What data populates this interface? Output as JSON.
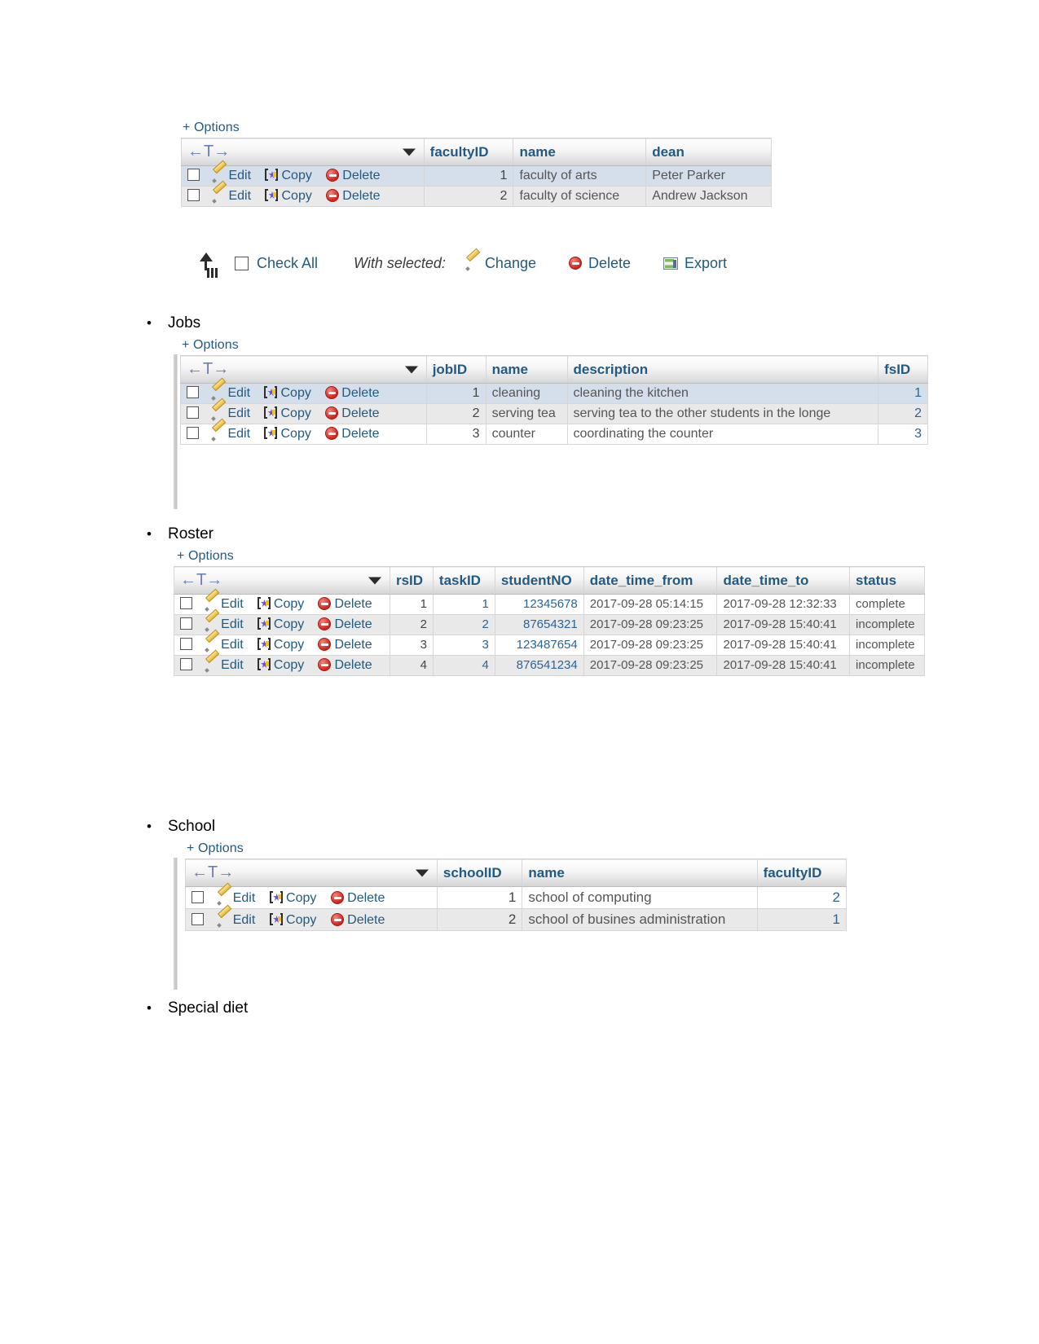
{
  "document": {
    "bullets": [
      {
        "label": "Jobs"
      },
      {
        "label": "Roster"
      },
      {
        "label": "School"
      },
      {
        "label": "Special diet"
      }
    ]
  },
  "common": {
    "options_label": "+ Options",
    "nav_label": "←T→",
    "edit_label": "Edit",
    "copy_label": "Copy",
    "delete_label": "Delete",
    "check_all_label": "Check All",
    "with_selected_label": "With selected:",
    "change_label": "Change",
    "export_label": "Export"
  },
  "tables": {
    "faculty": {
      "columns": [
        "facultyID",
        "name",
        "dean"
      ],
      "rows": [
        {
          "facultyID": "1",
          "name": "faculty of arts",
          "dean": "Peter Parker",
          "highlight": true
        },
        {
          "facultyID": "2",
          "name": "faculty of science",
          "dean": "Andrew Jackson",
          "highlight": false
        }
      ]
    },
    "jobs": {
      "columns": [
        "jobID",
        "name",
        "description",
        "fsID"
      ],
      "rows": [
        {
          "jobID": "1",
          "name": "cleaning",
          "description": "cleaning the kitchen",
          "fsID": "1",
          "highlight": true
        },
        {
          "jobID": "2",
          "name": "serving tea",
          "description": "serving tea to the other students in the longe",
          "fsID": "2",
          "highlight": false
        },
        {
          "jobID": "3",
          "name": "counter",
          "description": "coordinating the counter",
          "fsID": "3",
          "highlight": false
        }
      ]
    },
    "roster": {
      "columns": [
        "rsID",
        "taskID",
        "studentNO",
        "date_time_from",
        "date_time_to",
        "status"
      ],
      "rows": [
        {
          "rsID": "1",
          "taskID": "1",
          "studentNO": "12345678",
          "date_time_from": "2017-09-28 05:14:15",
          "date_time_to": "2017-09-28 12:32:33",
          "status": "complete"
        },
        {
          "rsID": "2",
          "taskID": "2",
          "studentNO": "87654321",
          "date_time_from": "2017-09-28 09:23:25",
          "date_time_to": "2017-09-28 15:40:41",
          "status": "incomplete"
        },
        {
          "rsID": "3",
          "taskID": "3",
          "studentNO": "123487654",
          "date_time_from": "2017-09-28 09:23:25",
          "date_time_to": "2017-09-28 15:40:41",
          "status": "incomplete"
        },
        {
          "rsID": "4",
          "taskID": "4",
          "studentNO": "876541234",
          "date_time_from": "2017-09-28 09:23:25",
          "date_time_to": "2017-09-28 15:40:41",
          "status": "incomplete"
        }
      ]
    },
    "school": {
      "columns": [
        "schoolID",
        "name",
        "facultyID"
      ],
      "rows": [
        {
          "schoolID": "1",
          "name": "school of computing",
          "facultyID": "2",
          "highlight": false
        },
        {
          "schoolID": "2",
          "name": "school of busines administration",
          "facultyID": "1",
          "highlight": false
        }
      ]
    }
  },
  "colors": {
    "link": "#235a81",
    "header_text": "#235a81",
    "row_highlight": "#d5dfeb",
    "row_alt": "#e9e9e9"
  }
}
